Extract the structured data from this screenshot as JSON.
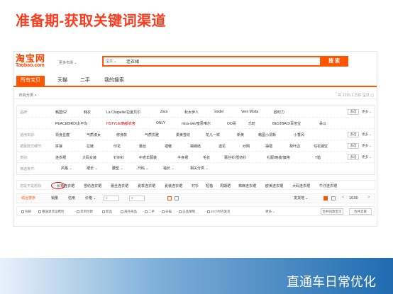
{
  "slide": {
    "title": "准备期-获取关键词渠道",
    "footer": "直通车日常优化"
  },
  "taobao": {
    "logo_cn": "淘宝网",
    "logo_en": "Taobao.com",
    "market": "更多市场 ⌄",
    "search": {
      "category": "宝贝 ⌄",
      "value": "连衣裙",
      "button": "搜 索"
    },
    "tabs": [
      "所有宝贝",
      "天猫",
      "二手",
      "我的搜索"
    ],
    "crumb": "所有分类 >",
    "count": "共 1015.1 万件 宝贝 ▢",
    "filters": [
      {
        "label": "品牌:",
        "items": [
          "韩国SZ",
          "韩衣",
          "La Chapelle/拉夏贝尔",
          "Zara",
          "秋水伊人",
          "snidel",
          "Vero Moda",
          "欧时力"
        ],
        "btn": "多选",
        "more": "更多 ⌄"
      },
      {
        "label": "",
        "items": [
          "PEACEBIRD/太平鸟",
          "HSTYLE/韩都衣舍",
          "ONLY",
          "miss-wei/蜜思唯尔",
          "OO哥",
          "乐町",
          "BESTBAO/百倍宝",
          "朵以"
        ],
        "btn": "",
        "more": ""
      },
      {
        "label": "适用年龄:",
        "items": [
          "领身显瘦",
          "气质淑女",
          "修身款",
          "气质优雅",
          "柔美雪纺",
          "花儿一样",
          "新美",
          "韩国小清新",
          "小香风"
        ],
        "btn": "多选",
        "more": "更多 ⌄"
      },
      {
        "label": "裙装款式细节:",
        "items": [
          "拼接",
          "拉链",
          "印花",
          "蕾丝",
          "褶皱",
          "蝴蝶结",
          "透花",
          "纱网",
          "抽褶",
          "荷叶边",
          "勾花镂空"
        ],
        "btn": "多选",
        "more": "更多 ⌄"
      },
      {
        "label": "类别:",
        "items": [
          "连衣裙",
          "大码女装",
          "针织衫",
          "中老年服装",
          "半身裙",
          "毛衣",
          "蕾丝衫/雪纺衫",
          "礼服/晚装/旗袍",
          "T恤"
        ],
        "btn": "多选",
        "more": "更多 ⌄"
      }
    ],
    "filter_options": {
      "label": "筛选条件:",
      "items": [
        "风格 ⌄",
        "裙长 ⌄",
        "腰型 ⌄",
        "尺码 ⌄",
        "袖长 ⌄",
        "相关分类 ⌄"
      ]
    },
    "guess": {
      "label": "您是不是想找:",
      "items": [
        "长袖连衣裙",
        "雪纺连衣裙",
        "蕾丝连衣裙",
        "夏季连衣裙",
        "夏装连衣裙",
        "衬衫",
        "短袖",
        "周期裙",
        "棉麻连衣裙",
        "欧美连衣裙",
        "大码连衣裙",
        "牛仔连衣裙"
      ]
    },
    "sort": {
      "items": [
        "综合排序",
        "销量",
        "信用",
        "价格 ⌄"
      ],
      "price_min": "¥",
      "price_max": "¥",
      "ship": "发货地 ⌄",
      "page": "1/100",
      "prev": "<",
      "next": ">"
    },
    "features": {
      "items": [
        "包邮",
        "赠送退货运费险",
        "货到付款",
        "新品",
        "海外商品",
        "二手",
        "天猫",
        "正品保障",
        "24小时内发货"
      ],
      "more": "更多 ⌄",
      "btn1": "合并同款宝贝",
      "btn2": "合并卖家"
    }
  }
}
